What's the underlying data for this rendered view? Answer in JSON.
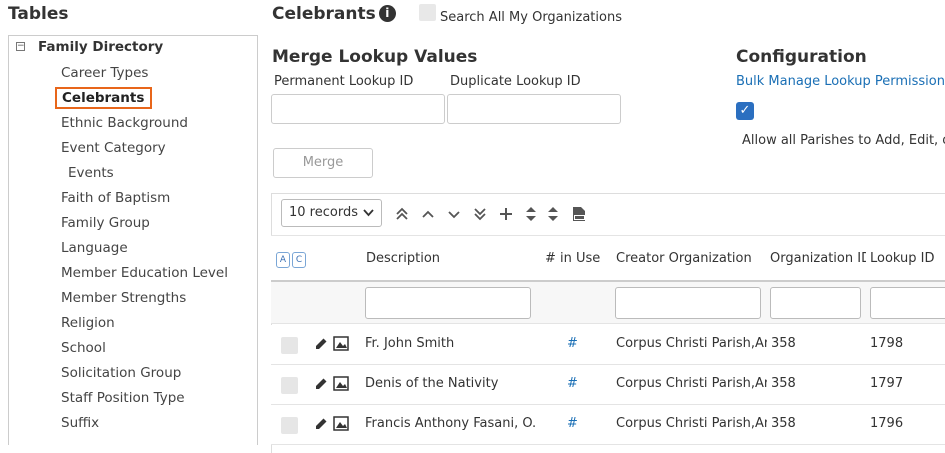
{
  "sidebar": {
    "title": "Tables",
    "root_label": "Family Directory",
    "items": [
      {
        "label": "Career Types"
      },
      {
        "label": "Celebrants"
      },
      {
        "label": "Ethnic Background"
      },
      {
        "label": "Event Category"
      },
      {
        "label": "Events"
      },
      {
        "label": "Faith of Baptism"
      },
      {
        "label": "Family Group"
      },
      {
        "label": "Language"
      },
      {
        "label": "Member Education Level"
      },
      {
        "label": "Member Strengths"
      },
      {
        "label": "Religion"
      },
      {
        "label": "School"
      },
      {
        "label": "Solicitation Group"
      },
      {
        "label": "Staff Position Type"
      },
      {
        "label": "Suffix"
      }
    ],
    "selected_label": "Celebrants"
  },
  "header": {
    "title": "Celebrants",
    "info_glyph": "i",
    "search_all_label": "Search All My Organizations"
  },
  "merge": {
    "title": "Merge Lookup Values",
    "permanent_label": "Permanent Lookup ID",
    "duplicate_label": "Duplicate Lookup ID",
    "permanent_value": "",
    "duplicate_value": "",
    "button_label": "Merge"
  },
  "config": {
    "title": "Configuration",
    "link_label": "Bulk Manage Lookup Permissions",
    "check_glyph": "✓",
    "allow_label": "Allow all Parishes to Add, Edit, or"
  },
  "grid": {
    "records_label": "10 records",
    "ac_labels": [
      "A",
      "C"
    ],
    "columns": [
      "Description",
      "# in Use",
      "Creator Organization",
      "Organization ID",
      "Lookup ID"
    ],
    "rows": [
      {
        "description": "Fr. John Smith",
        "in_use": "#",
        "creator": "Corpus Christi Parish,Ar",
        "org_id": "358",
        "lookup_id": "1798"
      },
      {
        "description": "Denis of the Nativity",
        "in_use": "#",
        "creator": "Corpus Christi Parish,Ar",
        "org_id": "358",
        "lookup_id": "1797"
      },
      {
        "description": "Francis Anthony Fasani, O.F",
        "in_use": "#",
        "creator": "Corpus Christi Parish,Ar",
        "org_id": "358",
        "lookup_id": "1796"
      }
    ]
  }
}
